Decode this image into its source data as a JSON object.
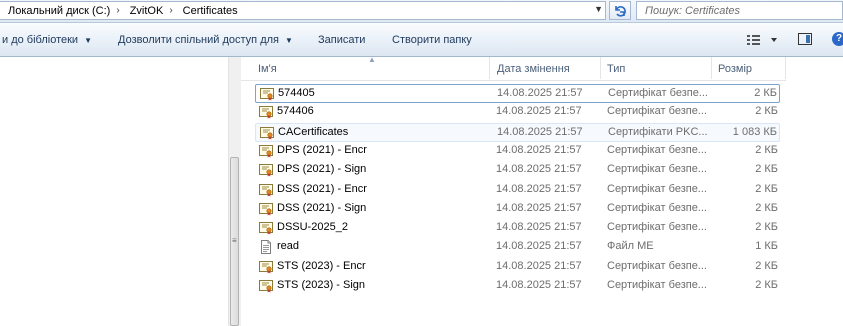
{
  "address": {
    "crumbs": [
      "Локальний диск (C:)",
      "ZvitOK",
      "Certificates"
    ],
    "search_placeholder": "Пошук: Certificates"
  },
  "toolbar": {
    "include_library": "и до бібліотеки",
    "share": "Дозволити спільний доступ для",
    "burn": "Записати",
    "new_folder": "Створити папку"
  },
  "columns": {
    "name": "Ім'я",
    "date": "Дата змінення",
    "type": "Тип",
    "size": "Розмір"
  },
  "files": [
    {
      "name": "574405",
      "date": "14.08.2025 21:57",
      "type": "Сертифікат безпе...",
      "size": "2 КБ",
      "icon": "certificate-icon"
    },
    {
      "name": "574406",
      "date": "14.08.2025 21:57",
      "type": "Сертифікат безпе...",
      "size": "2 КБ",
      "icon": "certificate-icon"
    },
    {
      "name": "CACertificates",
      "date": "14.08.2025 21:57",
      "type": "Сертифікати PKC...",
      "size": "1 083 КБ",
      "icon": "certificate-icon"
    },
    {
      "name": "DPS (2021) - Encr",
      "date": "14.08.2025 21:57",
      "type": "Сертифікат безпе...",
      "size": "2 КБ",
      "icon": "certificate-icon"
    },
    {
      "name": "DPS (2021) - Sign",
      "date": "14.08.2025 21:57",
      "type": "Сертифікат безпе...",
      "size": "2 КБ",
      "icon": "certificate-icon"
    },
    {
      "name": "DSS (2021) - Encr",
      "date": "14.08.2025 21:57",
      "type": "Сертифікат безпе...",
      "size": "2 КБ",
      "icon": "certificate-icon"
    },
    {
      "name": "DSS (2021) - Sign",
      "date": "14.08.2025 21:57",
      "type": "Сертифікат безпе...",
      "size": "2 КБ",
      "icon": "certificate-icon"
    },
    {
      "name": "DSSU-2025_2",
      "date": "14.08.2025 21:57",
      "type": "Сертифікат безпе...",
      "size": "2 КБ",
      "icon": "certificate-icon"
    },
    {
      "name": "read",
      "date": "14.08.2025 21:57",
      "type": "Файл ME",
      "size": "1 КБ",
      "icon": "document-icon"
    },
    {
      "name": "STS (2023) - Encr",
      "date": "14.08.2025 21:57",
      "type": "Сертифікат безпе...",
      "size": "2 КБ",
      "icon": "certificate-icon"
    },
    {
      "name": "STS (2023) - Sign",
      "date": "14.08.2025 21:57",
      "type": "Сертифікат безпе...",
      "size": "2 КБ",
      "icon": "certificate-icon"
    }
  ]
}
